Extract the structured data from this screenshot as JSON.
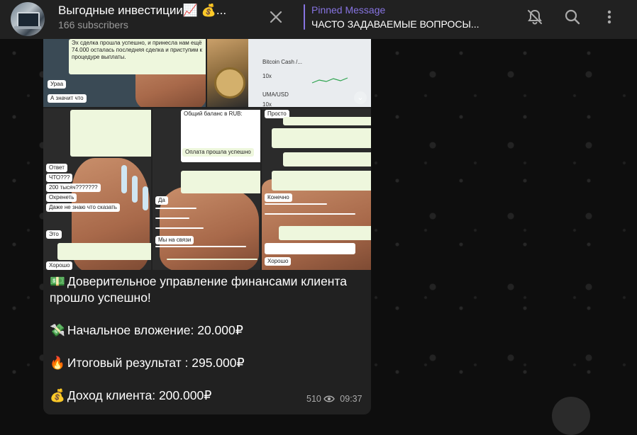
{
  "header": {
    "title": "Выгодные инвестиции📈 💰...",
    "subscribers": "166 subscribers",
    "pinned_label": "Pinned Message",
    "pinned_text": "ЧАСТО ЗАДАВАЕМЫЕ ВОПРОСЫ...",
    "icons": [
      "close-icon",
      "bell-off-icon",
      "search-icon",
      "more-vertical-icon"
    ]
  },
  "photos": {
    "top_left_lines": [
      "Эх сделка прошла успешно, и принесла",
      "нам ещё 74.000 осталась последняя",
      "сделка и приступим к процедуре",
      "выплаты.",
      "Ураа",
      "А значит что"
    ],
    "top_right_lines": [
      "Bitcoin Cash /...",
      "10x",
      "UMA/USD",
      "10x"
    ],
    "grid_lines_a": [
      "Ответ",
      "ЧТО???",
      "200 тысяч???????",
      "Охренеть",
      "Даже не знаю что сказать",
      "Хорошо",
      "Это"
    ],
    "grid_lines_b": [
      "Общий баланс в RUB:",
      "Оплата прошла успешно",
      "Да",
      "Мы на связи"
    ],
    "grid_lines_c": [
      "Просто",
      "Хорошо",
      "Конечно",
      "Понятно"
    ]
  },
  "message": {
    "line1_emoji": "💵",
    "line1": "Доверительное управление финансами клиента прошло успешно!",
    "line2_emoji": "💸",
    "line2": "Начальное вложение: 20.000₽",
    "line3_emoji": "🔥",
    "line3": "Итоговый результат : 295.000₽",
    "line4_emoji": "💰",
    "line4": "Доход клиента: 200.000₽",
    "views": "510",
    "time": "09:37"
  },
  "colors": {
    "header_bg": "#212121",
    "accent": "#8774e1",
    "bubble_bg": "#212121",
    "muted": "#aaaaaa"
  }
}
